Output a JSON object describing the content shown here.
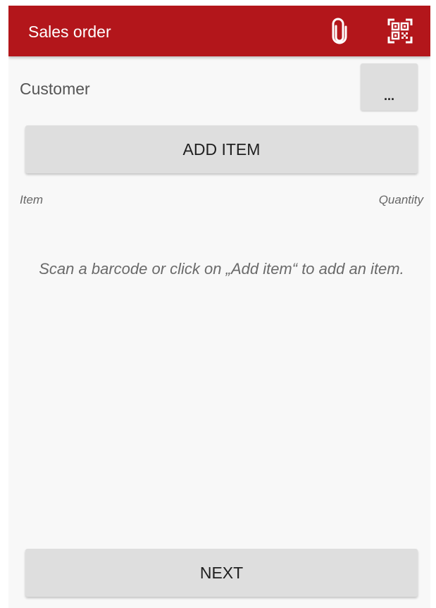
{
  "app_bar": {
    "title": "Sales order",
    "actions": [
      {
        "icon": "paperclip-icon"
      },
      {
        "icon": "qr-scan-icon"
      }
    ],
    "background_color": "#b3161b",
    "title_color": "#ffffff"
  },
  "customer": {
    "label": "Customer",
    "button_label": "..."
  },
  "add_item": {
    "label": "ADD ITEM"
  },
  "item_list": {
    "columns": [
      "Item",
      "Quantity"
    ],
    "empty_message": "Scan a barcode or click on „Add item“ to add an item."
  },
  "footer": {
    "next_label": "NEXT"
  }
}
